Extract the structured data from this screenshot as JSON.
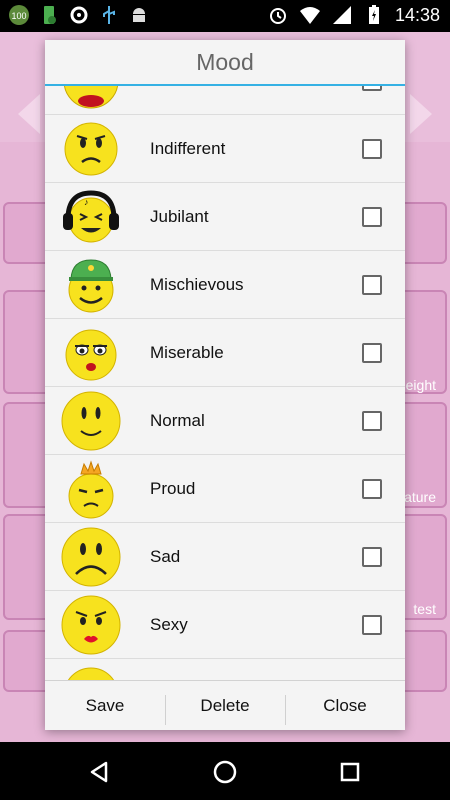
{
  "status_bar": {
    "time": "14:38",
    "left_icons": [
      "battery-100-icon",
      "battery-saver-icon",
      "sync-icon",
      "usb-icon",
      "android-debug-icon"
    ],
    "right_icons": [
      "alarm-icon",
      "wifi-icon",
      "signal-icon",
      "battery-icon"
    ],
    "badge_text": "100"
  },
  "background_app": {
    "labels": [
      "eight",
      "ature",
      "test"
    ]
  },
  "dialog": {
    "title": "Mood",
    "items": [
      {
        "label": "",
        "icon": "partial-emoji-icon",
        "checked": false
      },
      {
        "label": "Indifferent",
        "icon": "indifferent-emoji-icon",
        "checked": false
      },
      {
        "label": "Jubilant",
        "icon": "jubilant-headphones-emoji-icon",
        "checked": false
      },
      {
        "label": "Mischievous",
        "icon": "mischievous-cap-emoji-icon",
        "checked": false
      },
      {
        "label": "Miserable",
        "icon": "miserable-emoji-icon",
        "checked": false
      },
      {
        "label": "Normal",
        "icon": "normal-smile-emoji-icon",
        "checked": false
      },
      {
        "label": "Proud",
        "icon": "proud-crown-emoji-icon",
        "checked": false
      },
      {
        "label": "Sad",
        "icon": "sad-emoji-icon",
        "checked": false
      },
      {
        "label": "Sexy",
        "icon": "sexy-lips-emoji-icon",
        "checked": false
      },
      {
        "label": "",
        "icon": "partial-emoji-icon",
        "checked": false
      }
    ],
    "buttons": {
      "save": "Save",
      "delete": "Delete",
      "close": "Close"
    }
  },
  "colors": {
    "accent": "#35b1e4",
    "background_pink": "#e6b6d6",
    "emoji_yellow": "#f7e21e"
  }
}
